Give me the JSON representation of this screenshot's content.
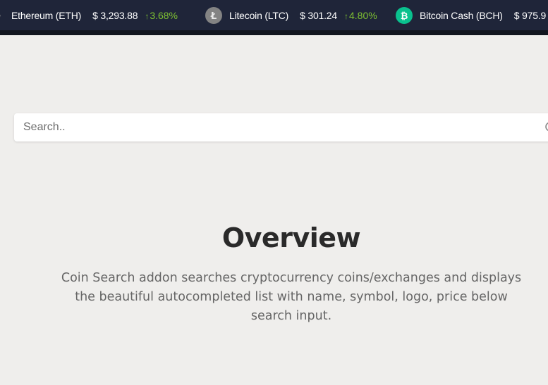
{
  "ticker": {
    "coins": [
      {
        "name": "Ethereum (ETH)",
        "price": "$ 3,293.88",
        "change": "3.68%",
        "icon": "ethereum-icon",
        "color": "#8c8c8c",
        "symbol": ""
      },
      {
        "name": "Litecoin (LTC)",
        "price": "$ 301.24",
        "change": "4.80%",
        "icon": "litecoin-icon",
        "color": "#838383",
        "symbol": "Ł"
      },
      {
        "name": "Bitcoin Cash (BCH)",
        "price": "$ 975.9",
        "change": "",
        "icon": "bitcoin-cash-icon",
        "color": "#0ac18e",
        "symbol": "₿"
      }
    ],
    "change_color": "#7ec132"
  },
  "search": {
    "placeholder": "Search.."
  },
  "overview": {
    "title": "Overview",
    "description": "Coin Search addon searches cryptocurrency coins/exchanges and displays the beautiful autocompleted list with name, symbol, logo, price below search input."
  }
}
